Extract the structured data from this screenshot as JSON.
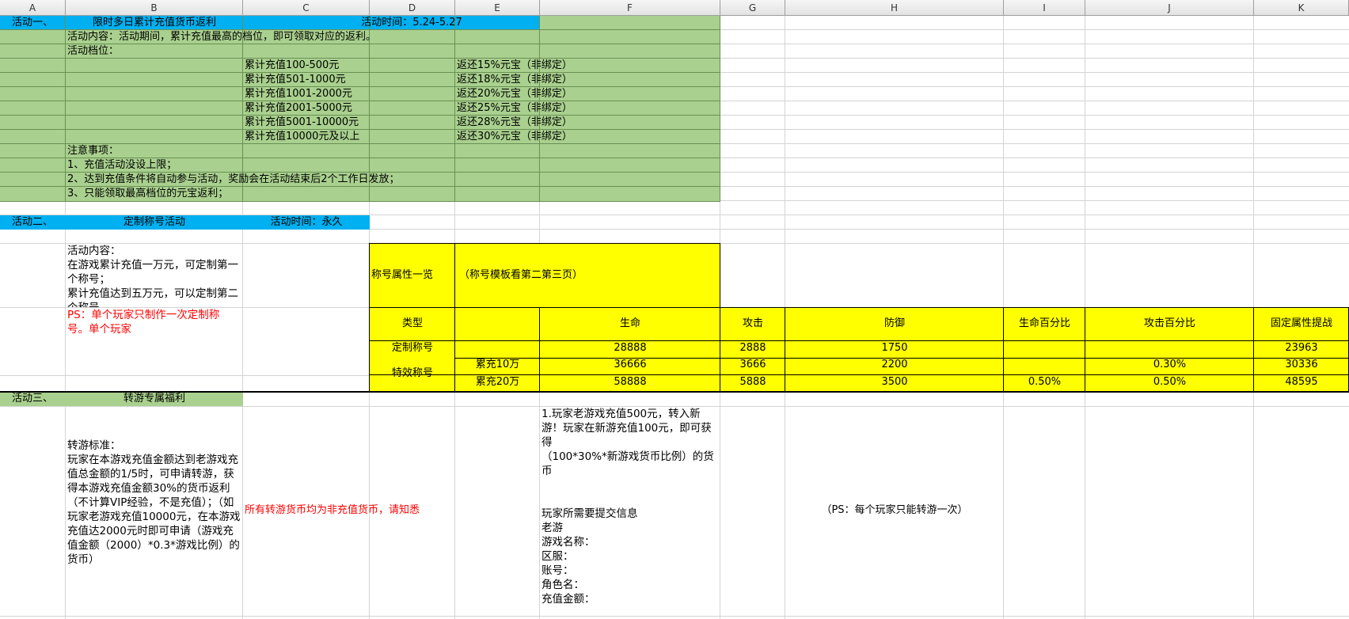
{
  "columns": [
    "A",
    "B",
    "C",
    "D",
    "E",
    "F",
    "G",
    "H",
    "I",
    "J",
    "K"
  ],
  "activity1": {
    "label": "活动一、",
    "title": "限时多日累计充值货币返利",
    "time": "活动时间：5.24-5.27",
    "content": "活动内容：活动期间，累计充值最高的档位，即可领取对应的返利。",
    "tiers_label": "活动档位：",
    "tiers": [
      {
        "range": "累计充值100-500元",
        "reward": "返还15%元宝（非绑定）"
      },
      {
        "range": "累计充值501-1000元",
        "reward": "返还18%元宝（非绑定）"
      },
      {
        "range": "累计充值1001-2000元",
        "reward": "返还20%元宝（非绑定）"
      },
      {
        "range": "累计充值2001-5000元",
        "reward": "返还25%元宝（非绑定）"
      },
      {
        "range": "累计充值5001-10000元",
        "reward": "返还28%元宝（非绑定）"
      },
      {
        "range": "累计充值10000元及以上",
        "reward": "返还30%元宝（非绑定）"
      }
    ],
    "notes_label": "注意事项：",
    "notes": [
      "1、充值活动没设上限；",
      "2、达到充值条件将自动参与活动，奖励会在活动结束后2个工作日发放；",
      "3、只能领取最高档位的元宝返利；"
    ]
  },
  "activity2": {
    "label": "活动二、",
    "title": "定制称号活动",
    "time": "活动时间：永久",
    "content": "活动内容：\n在游戏累计充值一万元，可定制第一个称号；\n累计充值达到五万元，可以定制第二个称号",
    "ps": "PS：单个玩家只制作一次定制称号。单个玩家",
    "table": {
      "attr_label": "称号属性一览",
      "template_note": "（称号模板看第二第三页）",
      "headers": [
        "类型",
        "",
        "生命",
        "攻击",
        "防御",
        "生命百分比",
        "攻击百分比",
        "固定属性提战"
      ],
      "row_custom": {
        "type": "定制称号",
        "sub": "",
        "hp": "28888",
        "atk": "2888",
        "def": "1750",
        "hp_pct": "",
        "atk_pct": "",
        "power": "23963"
      },
      "effect_type": "特效称号",
      "row_10w": {
        "sub": "累充10万",
        "hp": "36666",
        "atk": "3666",
        "def": "2200",
        "hp_pct": "",
        "atk_pct": "0.30%",
        "power": "30336"
      },
      "row_20w": {
        "sub": "累充20万",
        "hp": "58888",
        "atk": "5888",
        "def": "3500",
        "hp_pct": "0.50%",
        "atk_pct": "0.50%",
        "power": "48595"
      }
    }
  },
  "activity3": {
    "label": "活动三、",
    "title": "转游专属福利",
    "standard": "转游标准：\n玩家在本游戏充值金额达到老游戏充值总金额的1/5时，可申请转游，获得本游戏充值金额30%的货币返利（不计算VIP经验，不是充值）；（如玩家老游戏充值10000元，在本游戏充值达2000元时即可申请（游戏充值金额（2000）*0.3*游戏比例）的货币）",
    "notice": "所有转游货币均为非充值货币，请知悉",
    "example": "1.玩家老游戏充值500元，转入新游！玩家在新游充值100元，即可获得\n（100*30%*新游戏货币比例）的货币\n\n\n玩家所需要提交信息\n老游\n游戏名称：\n区服：\n账号：\n角色名：\n充值金额：",
    "ps": "（PS：每个玩家只能转游一次）"
  }
}
